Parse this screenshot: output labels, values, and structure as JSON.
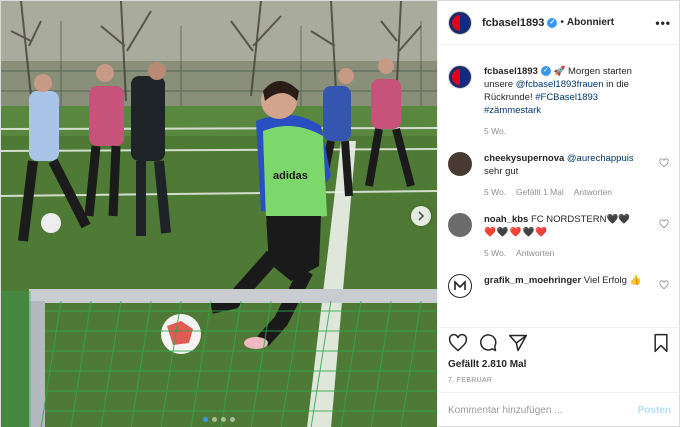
{
  "post": {
    "username": "fcbasel1893",
    "separator": "•",
    "follow_status": "Abonniert",
    "more_icon": "more-horizontal-icon",
    "caption": {
      "prefix_emoji": "🚀",
      "text_1": " Morgen starten unsere ",
      "mention": "@fcbasel1893frauen",
      "text_2": " in die Rückrunde! ",
      "hashtag_1": "#FCBasel1893",
      "hashtag_2": "#zämmestark",
      "time": "5 Wo."
    },
    "comments": [
      {
        "user": "cheekysupernova",
        "mention": "@aurechappuis",
        "text": " sehr gut",
        "time": "5 Wo.",
        "likes": "Gefällt 1 Mal",
        "reply": "Antworten"
      },
      {
        "user": "noah_kbs",
        "text": " FC NORDSTERN🖤🖤",
        "text_2": "❤️🖤❤️🖤❤️",
        "time": "5 Wo.",
        "reply": "Antworten"
      },
      {
        "user": "grafik_m_moehringer",
        "text": " Viel Erfolg ",
        "emoji": "👍"
      }
    ],
    "likes_text": "Gefällt 2.810 Mal",
    "date": "7. FEBRUAR",
    "comment_placeholder": "Kommentar hinzufügen ...",
    "post_button": "Posten",
    "carousel": {
      "total": 4,
      "active": 1
    }
  },
  "colors": {
    "verified": "#3897f0",
    "link": "#00376b",
    "post_disabled": "#b2dffc",
    "muted": "#8e8e8e"
  }
}
